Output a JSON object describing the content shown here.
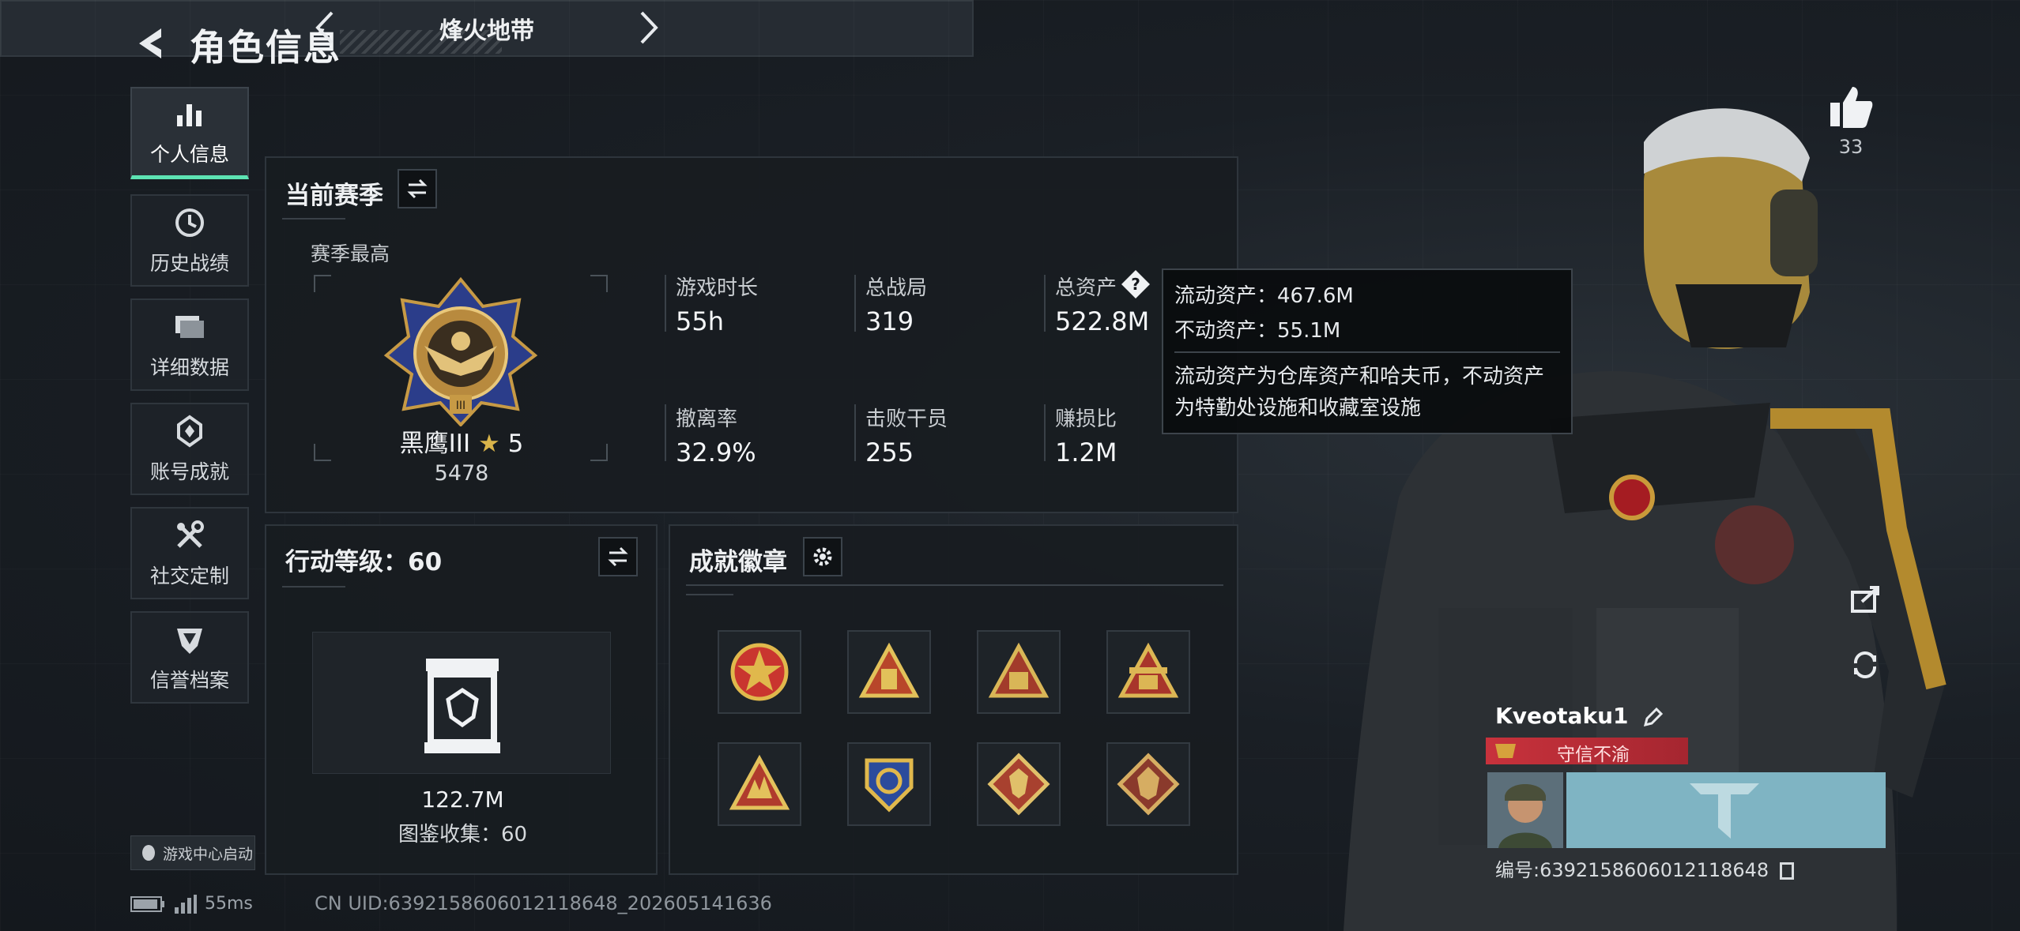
{
  "header": {
    "title": "角色信息"
  },
  "sidebar": {
    "items": [
      {
        "label": "个人信息",
        "icon": "bar-chart-icon",
        "active": true
      },
      {
        "label": "历史战绩",
        "icon": "clock-icon",
        "active": false
      },
      {
        "label": "详细数据",
        "icon": "folder-icon",
        "active": false
      },
      {
        "label": "账号成就",
        "icon": "trophy-icon",
        "active": false
      },
      {
        "label": "社交定制",
        "icon": "tools-icon",
        "active": false
      },
      {
        "label": "信誉档案",
        "icon": "shield-icon",
        "active": false
      }
    ],
    "launch_badge": "游戏中心启动"
  },
  "mode": {
    "title": "烽火地带"
  },
  "season": {
    "title": "当前赛季",
    "subtitle": "赛季最高",
    "rank_name": "黑鹰III",
    "rank_stars": "5",
    "rank_score": "5478",
    "stats": [
      {
        "label": "游戏时长",
        "value": "55h"
      },
      {
        "label": "总战局",
        "value": "319"
      },
      {
        "label": "总资产",
        "value": "522.8M"
      },
      {
        "label": "撤离率",
        "value": "32.9%"
      },
      {
        "label": "击败干员",
        "value": "255"
      },
      {
        "label": "赚损比",
        "value": "1.2M"
      }
    ]
  },
  "tooltip": {
    "liquid": "流动资产：467.6M",
    "fixed": "不动资产：55.1M",
    "desc_line1": "流动资产为仓库资产和哈夫币，不动资产",
    "desc_line2": "为特勤处设施和收藏室设施"
  },
  "action_level": {
    "title": "行动等级：60",
    "value": "122.7M",
    "collection": "图鉴收集：60"
  },
  "achievements": {
    "title": "成就徽章",
    "badges": [
      {
        "icon": "star-emblem-icon",
        "colors": [
          "#c9352f",
          "#e0b84c"
        ]
      },
      {
        "icon": "pyramid-barrel-icon",
        "colors": [
          "#b8462a",
          "#e2c15a"
        ]
      },
      {
        "icon": "pyramid-58-icon",
        "colors": [
          "#a23b2b",
          "#d9b657"
        ]
      },
      {
        "icon": "pyramid-crown-icon",
        "colors": [
          "#a8352b",
          "#dcb654"
        ]
      },
      {
        "icon": "pyramid-hand-icon",
        "colors": [
          "#b03b2d",
          "#e3c15c"
        ]
      },
      {
        "icon": "tri-shield-icon",
        "colors": [
          "#2b4b9c",
          "#e0b84c"
        ]
      },
      {
        "icon": "wolf-diamond-icon",
        "colors": [
          "#a8412f",
          "#e0c06a"
        ]
      },
      {
        "icon": "wolf-diamond-2-icon",
        "colors": [
          "#8a3a2c",
          "#d6ad62"
        ]
      }
    ]
  },
  "character": {
    "likes": "33",
    "name": "Kveotaku1",
    "title": "守信不渝",
    "uid": "编号:6392158606012118648"
  },
  "footer": {
    "ping": "55ms",
    "uid_line": "CN UID:6392158606012118648_202605141636"
  },
  "colors": {
    "accent": "#5de3b3",
    "title_red": "#c8323c",
    "gold": "#d6a23c"
  }
}
